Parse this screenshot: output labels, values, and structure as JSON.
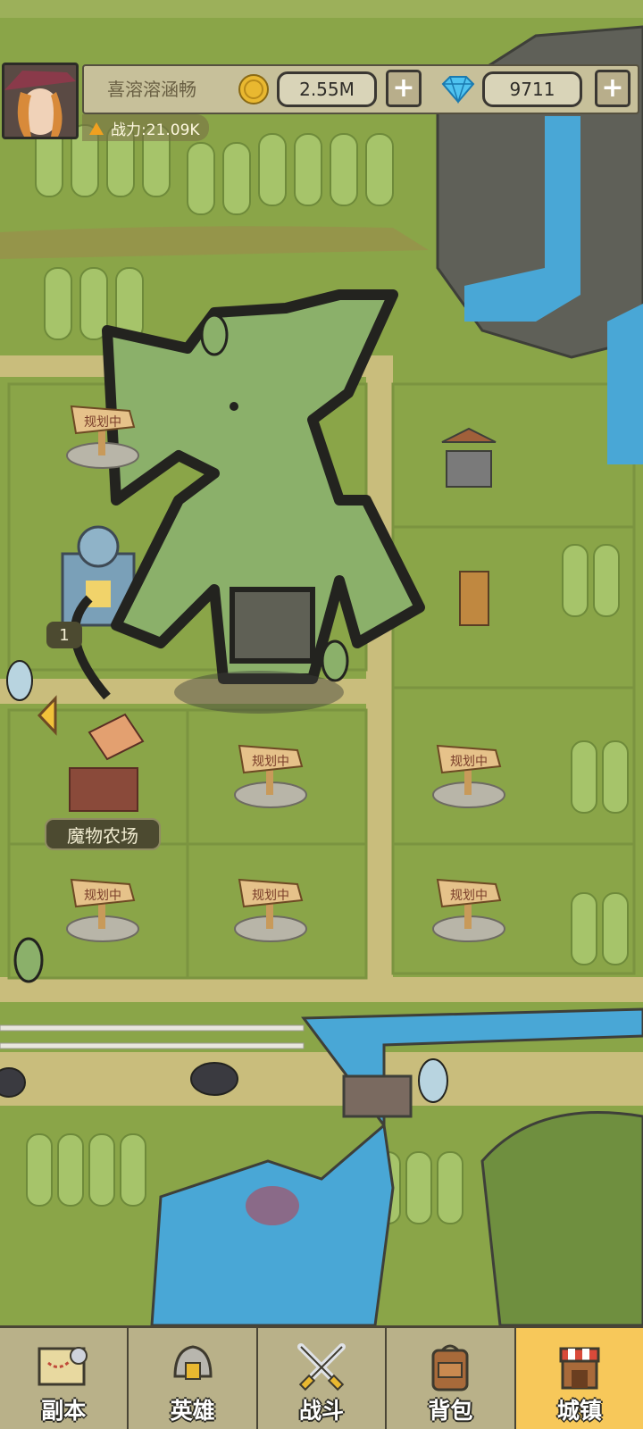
{
  "player": {
    "name": "喜溶溶涵畅",
    "power_label": "战力:21.09K"
  },
  "currency": {
    "gold": "2.55M",
    "gems": "9711"
  },
  "map": {
    "sign_text": "规划中",
    "farm_label": "魔物农场",
    "building_level_fragment": "1"
  },
  "nav": {
    "tabs": [
      {
        "label": "副本",
        "icon": "map-scroll-icon"
      },
      {
        "label": "英雄",
        "icon": "helmet-icon"
      },
      {
        "label": "战斗",
        "icon": "crossed-swords-icon"
      },
      {
        "label": "背包",
        "icon": "backpack-icon"
      },
      {
        "label": "城镇",
        "icon": "shop-stall-icon"
      }
    ],
    "active_tab": "城镇"
  },
  "colors": {
    "grass": "#8aa548",
    "path": "#c9bd7c",
    "water": "#49a7d6",
    "active_tab": "#f7c85a",
    "goblin": "#8bb06a"
  }
}
